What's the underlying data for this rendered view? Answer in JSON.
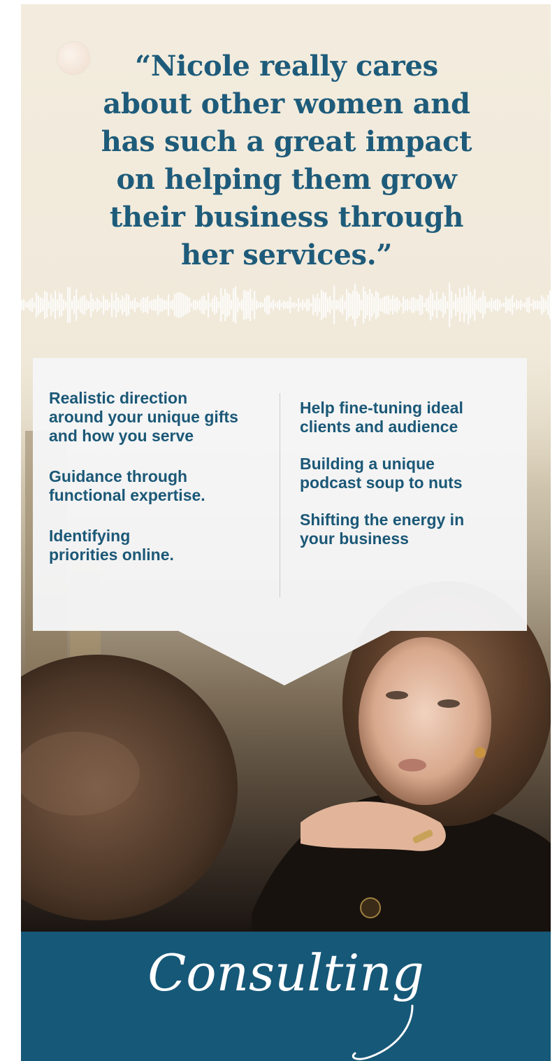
{
  "quote": {
    "text": "“Nicole really cares about other women and has such a great impact on helping them grow their business through her services.”",
    "lines": [
      "“Nicole really cares",
      "about other women and",
      "has such a great impact",
      "on helping them grow",
      "their business through",
      "her services.”"
    ]
  },
  "services": {
    "left": [
      "Realistic direction\naround your unique gifts\nand how you serve",
      "Guidance through\nfunctional expertise.",
      "Identifying\npriorities online."
    ],
    "right": [
      "Help fine-tuning ideal\nclients and audience",
      "Building a unique\npodcast soup to nuts",
      "Shifting the energy in\nyour business"
    ]
  },
  "footer": {
    "title": "Consulting"
  },
  "colors": {
    "quote": "#1e5b7a",
    "services_text": "#1b5877",
    "footer_bg": "#165878",
    "background_top": "#f3ecde",
    "panel": "#f6f6f7"
  },
  "images": {
    "photo": "woman-resting-chin-on-hand-at-mirror"
  }
}
